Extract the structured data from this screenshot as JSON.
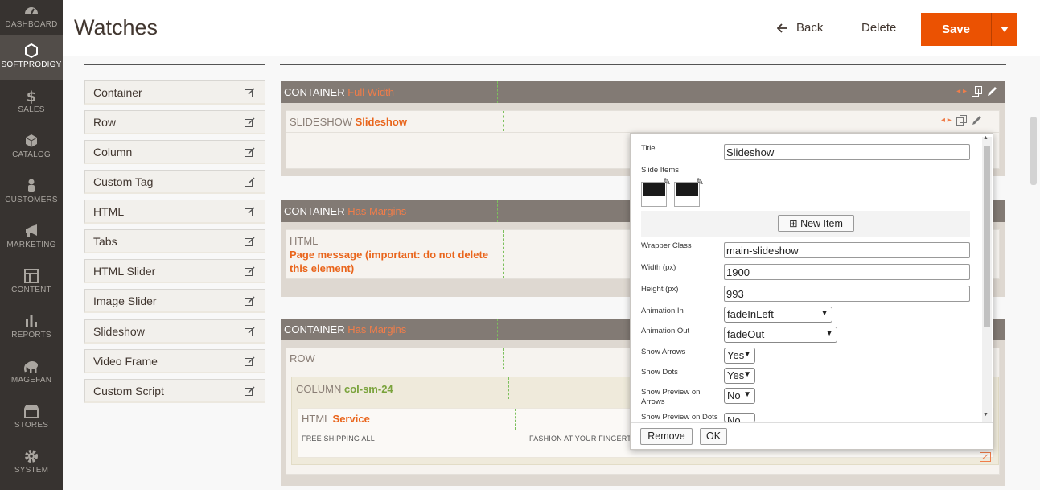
{
  "sidebar": {
    "items": [
      {
        "label": "DASHBOARD",
        "icon": "dashboard-icon"
      },
      {
        "label": "SOFTPRODIGY",
        "icon": "hexagon-icon"
      },
      {
        "label": "SALES",
        "icon": "dollar-icon"
      },
      {
        "label": "CATALOG",
        "icon": "cube-icon"
      },
      {
        "label": "CUSTOMERS",
        "icon": "person-icon"
      },
      {
        "label": "MARKETING",
        "icon": "megaphone-icon"
      },
      {
        "label": "CONTENT",
        "icon": "layout-icon"
      },
      {
        "label": "REPORTS",
        "icon": "bar-chart-icon"
      },
      {
        "label": "MAGEFAN",
        "icon": "elephant-icon"
      },
      {
        "label": "STORES",
        "icon": "store-icon"
      },
      {
        "label": "SYSTEM",
        "icon": "gear-icon"
      }
    ]
  },
  "header": {
    "title": "Watches",
    "back_label": "Back",
    "delete_label": "Delete",
    "save_label": "Save"
  },
  "elements": [
    "Container",
    "Row",
    "Column",
    "Custom Tag",
    "HTML",
    "Tabs",
    "HTML Slider",
    "Image Slider",
    "Slideshow",
    "Video Frame",
    "Custom Script"
  ],
  "canvas": {
    "container1": {
      "type": "CONTAINER",
      "name": "Full Width"
    },
    "slideshow": {
      "type": "SLIDESHOW",
      "name": "Slideshow"
    },
    "container2": {
      "type": "CONTAINER",
      "name": "Has Margins"
    },
    "html1": {
      "type": "HTML",
      "message": "Page message (important: do not delete this element)"
    },
    "container3": {
      "type": "CONTAINER",
      "name": "Has Margins"
    },
    "row": {
      "type": "ROW"
    },
    "column": {
      "type": "COLUMN",
      "name": "col-sm-24"
    },
    "html2": {
      "type": "HTML",
      "name": "Service",
      "text1": "FREE SHIPPING ALL",
      "text2": "FASHION AT YOUR FINGERTIP"
    }
  },
  "popup": {
    "title_label": "Title",
    "title_value": "Slideshow",
    "slide_items_label": "Slide Items",
    "new_item_label": "New Item",
    "wrapper_label": "Wrapper Class",
    "wrapper_value": "main-slideshow",
    "width_label": "Width (px)",
    "width_value": "1900",
    "height_label": "Height (px)",
    "height_value": "993",
    "anim_in_label": "Animation In",
    "anim_in_value": "fadeInLeft",
    "anim_out_label": "Animation Out",
    "anim_out_value": "fadeOut",
    "arrows_label": "Show Arrows",
    "arrows_value": "Yes",
    "dots_label": "Show Dots",
    "dots_value": "Yes",
    "preview_arrows_label": "Show Preview on Arrows",
    "preview_arrows_value": "No",
    "preview_dots_label": "Show Preview on Dots",
    "preview_dots_value": "No",
    "remove_label": "Remove",
    "ok_label": "OK"
  },
  "colors": {
    "accent": "#eb5202",
    "sidebar": "#373330",
    "container_bar": "#827a74"
  }
}
